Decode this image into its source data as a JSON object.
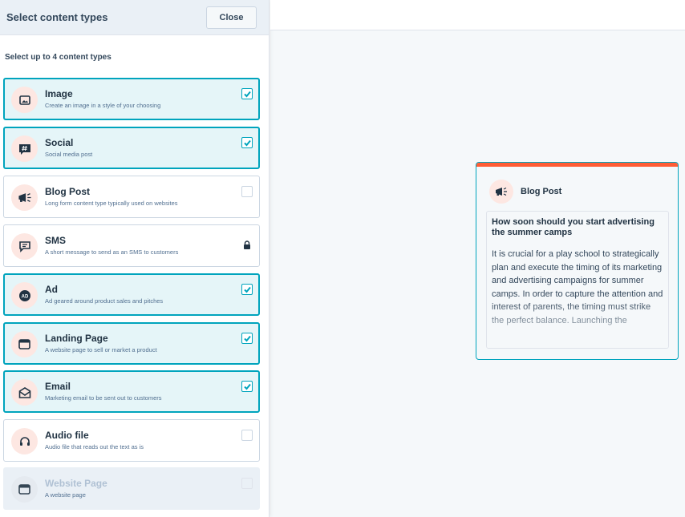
{
  "panel": {
    "title": "Select content types",
    "close_label": "Close",
    "subtitle": "Select up to 4 content types"
  },
  "content_types": [
    {
      "title": "Image",
      "desc": "Create an image in a style of your choosing",
      "icon": "image-icon",
      "state": "checked"
    },
    {
      "title": "Social",
      "desc": "Social media post",
      "icon": "hashtag-icon",
      "state": "checked"
    },
    {
      "title": "Blog Post",
      "desc": "Long form content type typically used on websites",
      "icon": "megaphone-icon",
      "state": "unchecked"
    },
    {
      "title": "SMS",
      "desc": "A short message to send as an SMS to customers",
      "icon": "chat-icon",
      "state": "locked"
    },
    {
      "title": "Ad",
      "desc": "Ad geared around product sales and pitches",
      "icon": "ad-icon",
      "state": "checked"
    },
    {
      "title": "Landing Page",
      "desc": "A website page to sell or market a product",
      "icon": "browser-icon",
      "state": "checked"
    },
    {
      "title": "Email",
      "desc": "Marketing email to be sent out to customers",
      "icon": "envelope-icon",
      "state": "checked"
    },
    {
      "title": "Audio file",
      "desc": "Audio file that reads out the text as is",
      "icon": "headphones-icon",
      "state": "unchecked"
    },
    {
      "title": "Website Page",
      "desc": "A website page",
      "icon": "browser-icon",
      "state": "disabled"
    }
  ],
  "preview": {
    "type_label": "Blog Post",
    "heading": "How soon should you start advertising the summer camps",
    "body": "It is crucial for a play school to strategically plan and execute the timing of its marketing and advertising campaigns for summer camps. In order to capture the attention and interest of parents, the timing must strike the perfect balance. Launching the"
  },
  "colors": {
    "accent": "#00a4bd",
    "brand_orange": "#ff5c35",
    "icon_bg": "#fde7e2"
  }
}
